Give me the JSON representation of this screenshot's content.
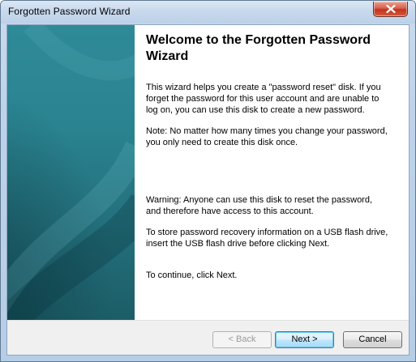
{
  "window": {
    "title": "Forgotten Password Wizard"
  },
  "page": {
    "heading": "Welcome to the Forgotten Password Wizard",
    "paragraphs": [
      "This wizard helps you create a \"password reset\" disk. If you forget the password for this user account and are unable to log on, you can use this disk to create a new password.",
      "Note: No matter how many times you change your password, you only need to create this disk once.",
      "Warning: Anyone can use this disk to reset the password, and therefore have access to this account.",
      "To store password recovery information on a USB flash drive, insert the USB flash drive before clicking Next.",
      "To continue, click Next."
    ]
  },
  "buttons": {
    "back": "< Back",
    "next": "Next >",
    "cancel": "Cancel"
  },
  "icons": {
    "close": "close-icon"
  },
  "colors": {
    "side_panel": "#2a8390",
    "close_button": "#c2331d",
    "default_button_border": "#3c7fb1"
  }
}
